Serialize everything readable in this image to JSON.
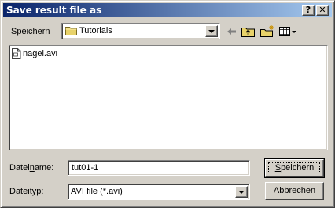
{
  "window": {
    "title": "Save result file as",
    "help_label": "?",
    "close_label": "✕"
  },
  "location": {
    "label_prefix": "Spe",
    "label_accel": "i",
    "label_suffix": "chern",
    "value": "Tutorials"
  },
  "toolbar": {
    "back_icon": "back-arrow-icon",
    "up_icon": "up-folder-icon",
    "new_folder_icon": "new-folder-icon",
    "view_menu_icon": "view-menu-icon"
  },
  "files": [
    {
      "name": "nagel.avi",
      "icon": "avi-file-icon"
    }
  ],
  "filename": {
    "label_prefix": "Datei",
    "label_accel": "n",
    "label_suffix": "ame:",
    "value": "tut01-1"
  },
  "filetype": {
    "label_prefix": "Datei",
    "label_accel": "t",
    "label_suffix": "yp:",
    "value": "AVI file (*.avi)"
  },
  "buttons": {
    "save_prefix": "",
    "save_accel": "S",
    "save_suffix": "peichern",
    "cancel": "Abbrechen"
  },
  "colors": {
    "face": "#d4d0c8",
    "title_start": "#0a246a",
    "title_end": "#a6caf0",
    "folder": "#e8d26a"
  }
}
